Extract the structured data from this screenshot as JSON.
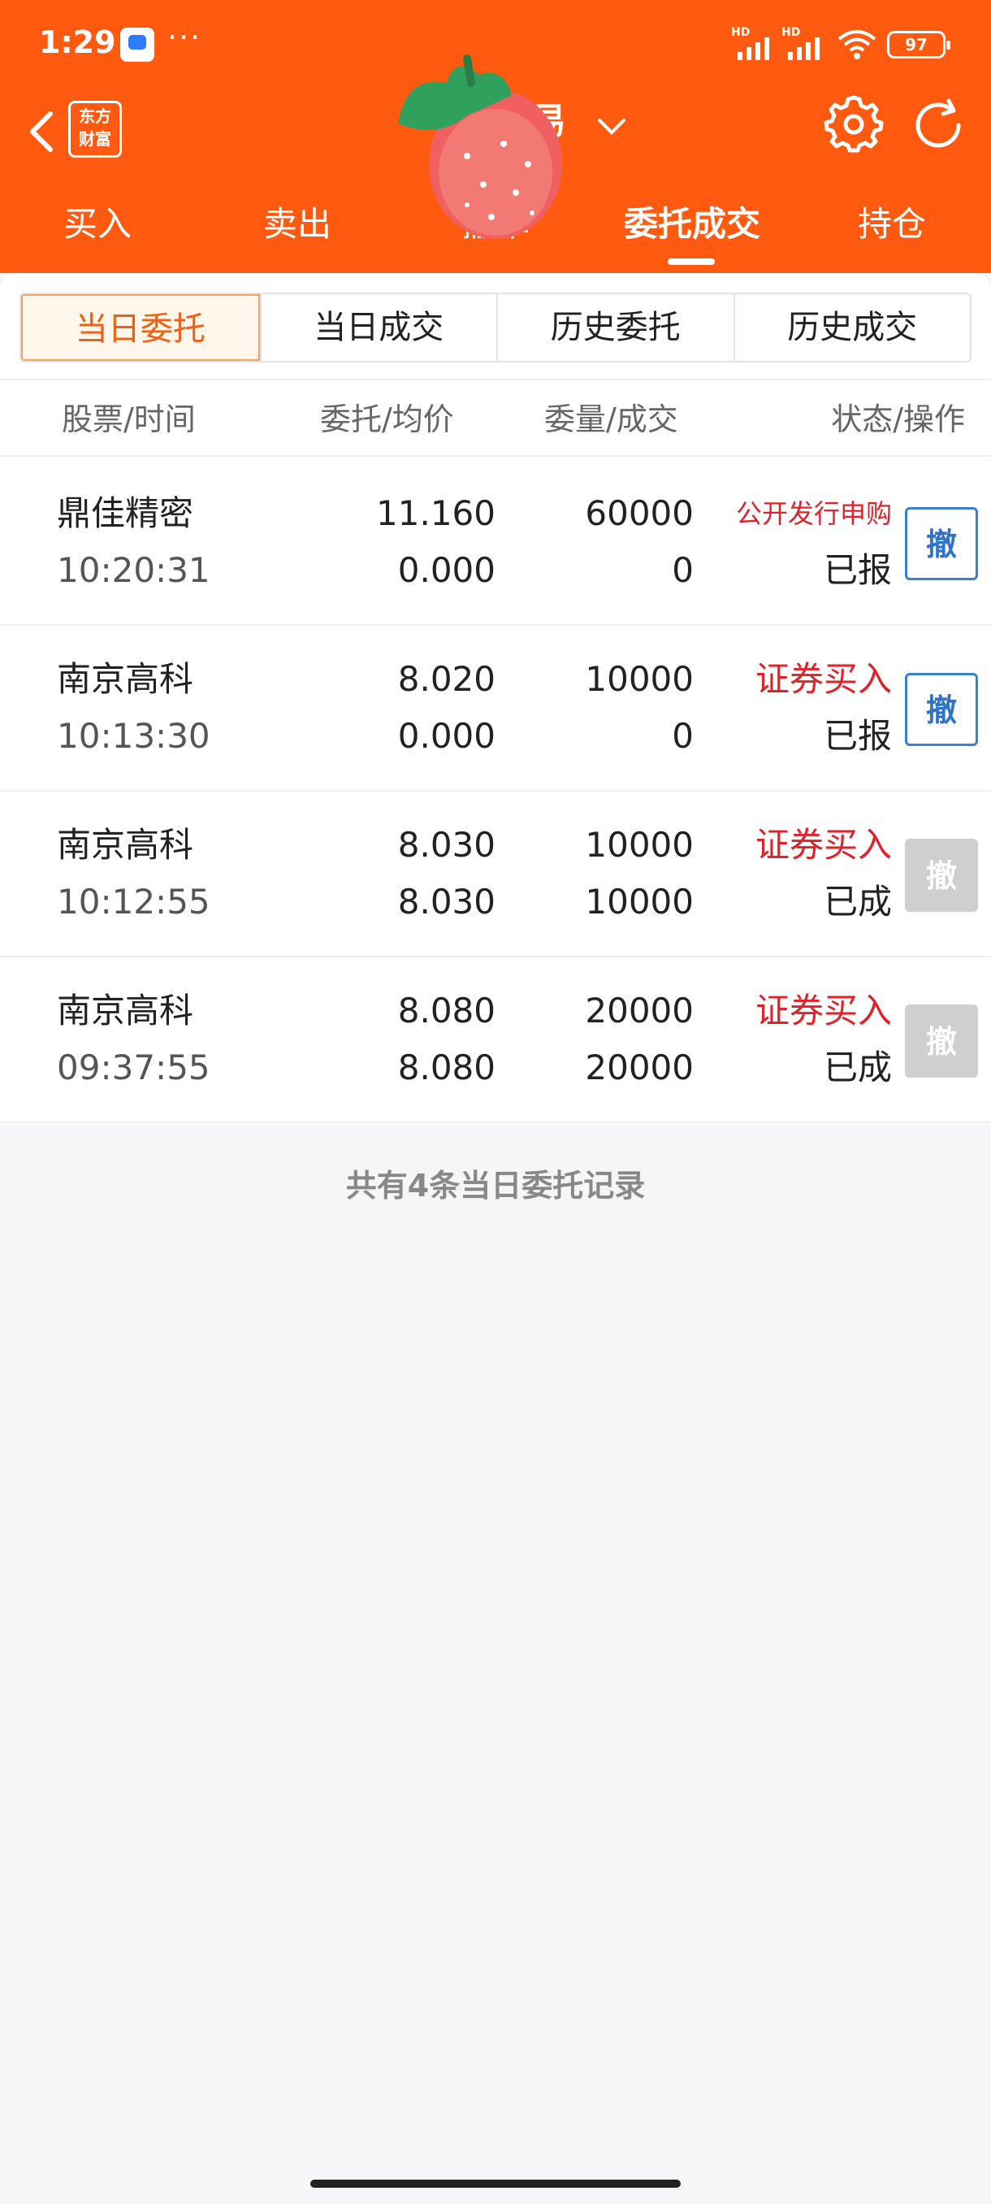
{
  "status_bar": {
    "time": "1:29",
    "more": "···",
    "signal1_label": "HD",
    "signal2_label": "HD",
    "battery": "97"
  },
  "nav": {
    "logo_line1": "东方",
    "logo_line2": "财富",
    "title": "易"
  },
  "tabs": [
    {
      "label": "买入"
    },
    {
      "label": "卖出"
    },
    {
      "label": "撤单"
    },
    {
      "label": "委托成交"
    },
    {
      "label": "持仓"
    }
  ],
  "segments": [
    {
      "label": "当日委托"
    },
    {
      "label": "当日成交"
    },
    {
      "label": "历史委托"
    },
    {
      "label": "历史成交"
    }
  ],
  "columns": {
    "stock_time": "股票/时间",
    "price_avg": "委托/均价",
    "qty_deal": "委量/成交",
    "status_op": "状态/操作"
  },
  "orders": [
    {
      "name": "鼎佳精密",
      "time": "10:20:31",
      "price": "11.160",
      "avg": "0.000",
      "qty": "60000",
      "deal": "0",
      "op": "公开发行申购",
      "status": "已报",
      "cancel": "撤",
      "cancelable": true
    },
    {
      "name": "南京高科",
      "time": "10:13:30",
      "price": "8.020",
      "avg": "0.000",
      "qty": "10000",
      "deal": "0",
      "op": "证券买入",
      "status": "已报",
      "cancel": "撤",
      "cancelable": true
    },
    {
      "name": "南京高科",
      "time": "10:12:55",
      "price": "8.030",
      "avg": "8.030",
      "qty": "10000",
      "deal": "10000",
      "op": "证券买入",
      "status": "已成",
      "cancel": "撤",
      "cancelable": false
    },
    {
      "name": "南京高科",
      "time": "09:37:55",
      "price": "8.080",
      "avg": "8.080",
      "qty": "20000",
      "deal": "20000",
      "op": "证券买入",
      "status": "已成",
      "cancel": "撤",
      "cancelable": false
    }
  ],
  "footer_note": "共有4条当日委托记录",
  "colors": {
    "header": "#ff5a0f",
    "active_segment_text": "#f06010",
    "buy_red": "#e0222a",
    "cancel_blue": "#2f73c8"
  },
  "icons": [
    "back-arrow-icon",
    "gear-icon",
    "refresh-icon",
    "chevron-down-icon",
    "wifi-icon",
    "strawberry-sticker-icon"
  ]
}
